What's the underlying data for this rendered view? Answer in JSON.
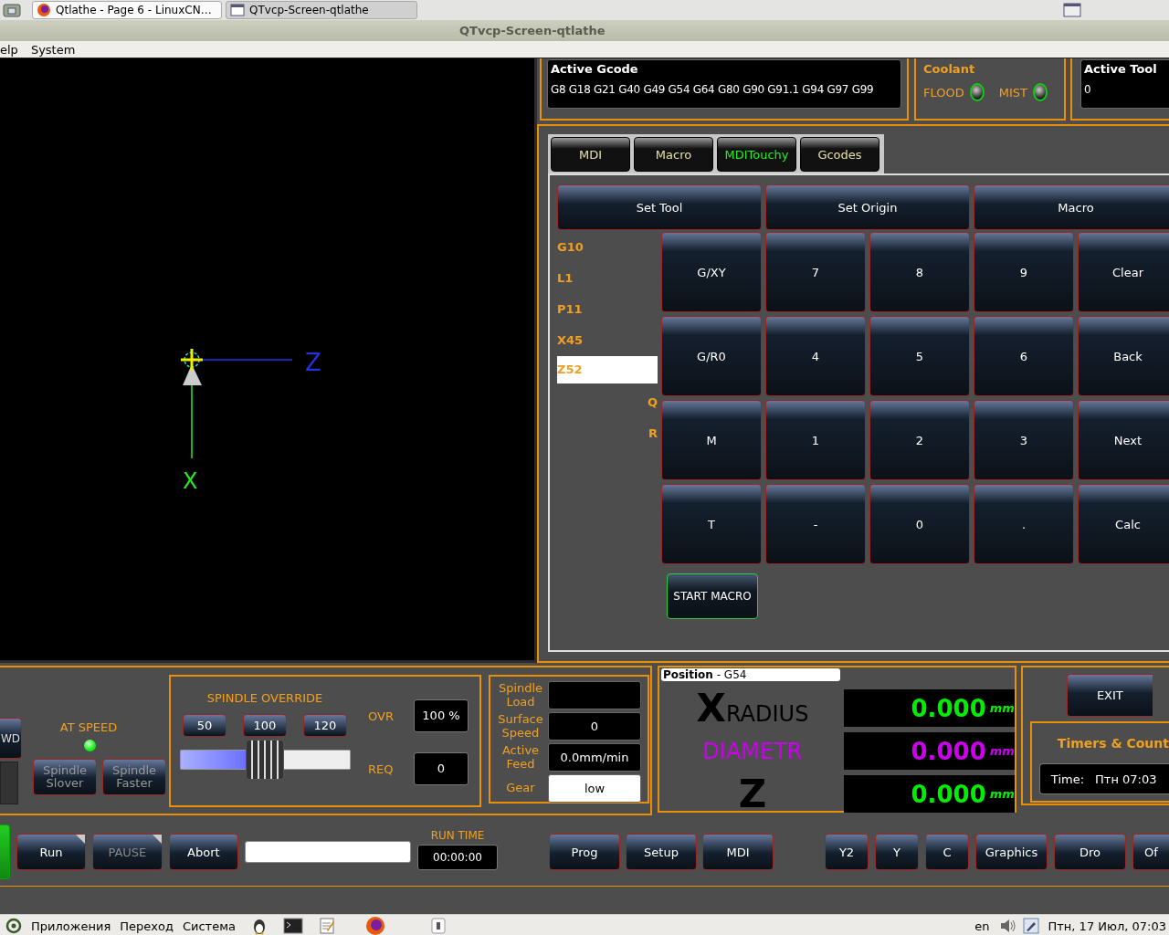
{
  "os_top_bar": {
    "tabs": [
      {
        "label": "Qtlathe - Page 6 - LinuxCN…",
        "selected": true
      },
      {
        "label": "QTvcp-Screen-qtlathe",
        "selected": false
      }
    ]
  },
  "window": {
    "title": "QTvcp-Screen-qtlathe"
  },
  "menu": [
    "elp",
    "System"
  ],
  "graphics": {
    "z_label": "Z",
    "x_label": "X"
  },
  "active_gcode": {
    "title": "Active Gcode",
    "value": "G8 G18 G21 G40 G49 G54 G64 G80 G90 G91.1 G94 G97 G99"
  },
  "coolant": {
    "title": "Coolant",
    "items": [
      {
        "label": "FLOOD",
        "on": false
      },
      {
        "label": "MIST",
        "on": false
      }
    ]
  },
  "active_tool": {
    "title": "Active Tool",
    "value": "0"
  },
  "tabs": [
    {
      "label": "MDI",
      "selected": false
    },
    {
      "label": "Macro",
      "selected": false
    },
    {
      "label": "MDITouchy",
      "selected": true
    },
    {
      "label": "Gcodes",
      "selected": false
    }
  ],
  "modes": [
    "Set Tool",
    "Set Origin",
    "Macro"
  ],
  "params": [
    {
      "label": "G10",
      "kind": "word",
      "selected": false
    },
    {
      "label": "L1",
      "kind": "word",
      "selected": false
    },
    {
      "label": "P11",
      "kind": "word",
      "selected": false
    },
    {
      "label": "X45",
      "kind": "word",
      "selected": false
    },
    {
      "label": "Z52",
      "kind": "word",
      "selected": true
    },
    {
      "label": "Q",
      "kind": "letter",
      "selected": false
    },
    {
      "label": "R",
      "kind": "letter",
      "selected": false
    }
  ],
  "keypad": [
    [
      "G/XY",
      "7",
      "8",
      "9",
      "Clear"
    ],
    [
      "G/R0",
      "4",
      "5",
      "6",
      "Back"
    ],
    [
      "M",
      "1",
      "2",
      "3",
      "Next"
    ],
    [
      "T",
      "-",
      "0",
      ".",
      "Calc"
    ]
  ],
  "start_button": "START MACRO",
  "spindle": {
    "dir_button": "WD",
    "at_speed": {
      "label": "AT SPEED",
      "on": true
    },
    "buttons": [
      "Spindle Slover",
      "Spindle Faster"
    ]
  },
  "spindle_override": {
    "title": "SPINDLE OVERRIDE",
    "presets": [
      "50",
      "100",
      "120"
    ],
    "level": 0.5,
    "readings": [
      {
        "label": "OVR",
        "value": "100 %"
      },
      {
        "label": "REQ",
        "value": "0"
      }
    ]
  },
  "spindle_info": [
    {
      "label": "Spindle Load",
      "kind": "dark"
    },
    {
      "label": "Surface Speed",
      "value": "0",
      "kind": "dark"
    },
    {
      "label": "Active Feed",
      "value": "0.0mm/min",
      "kind": "dark"
    },
    {
      "label": "Gear",
      "value": "low",
      "kind": "light"
    }
  ],
  "position": {
    "title": "**Position** - G54",
    "axes": [
      {
        "letter": "X",
        "name": "RADIUS",
        "value": "0.000",
        "unit": "mm",
        "color": "#00ee00"
      },
      {
        "name": "DIAMETR",
        "value": "0.000",
        "unit": "mm",
        "color": "#cc00ee"
      },
      {
        "letter": "Z",
        "value": "0.000",
        "unit": "mm",
        "color": "#00ee00"
      }
    ]
  },
  "exit_button": "EXIT",
  "timers": {
    "title": "Timers & Count",
    "label": "Time:",
    "value": "Птн 07:03"
  },
  "action_buttons": [
    {
      "label": "Run",
      "disabled": false
    },
    {
      "label": "PAUSE",
      "disabled": true
    },
    {
      "label": "Abort",
      "disabled": false
    }
  ],
  "run_time": {
    "label": "RUN TIME",
    "value": "00:00:00"
  },
  "page_buttons": [
    "Prog",
    "Setup",
    "MDI"
  ],
  "view_buttons": [
    "Y2",
    "Y",
    "C",
    "Graphics",
    "Dro",
    "Of"
  ],
  "os_bottom_bar": {
    "menus": [
      "Приложения",
      "Переход",
      "Система"
    ],
    "language": "en",
    "clock": "Птн, 17 Июл, 07:03"
  }
}
